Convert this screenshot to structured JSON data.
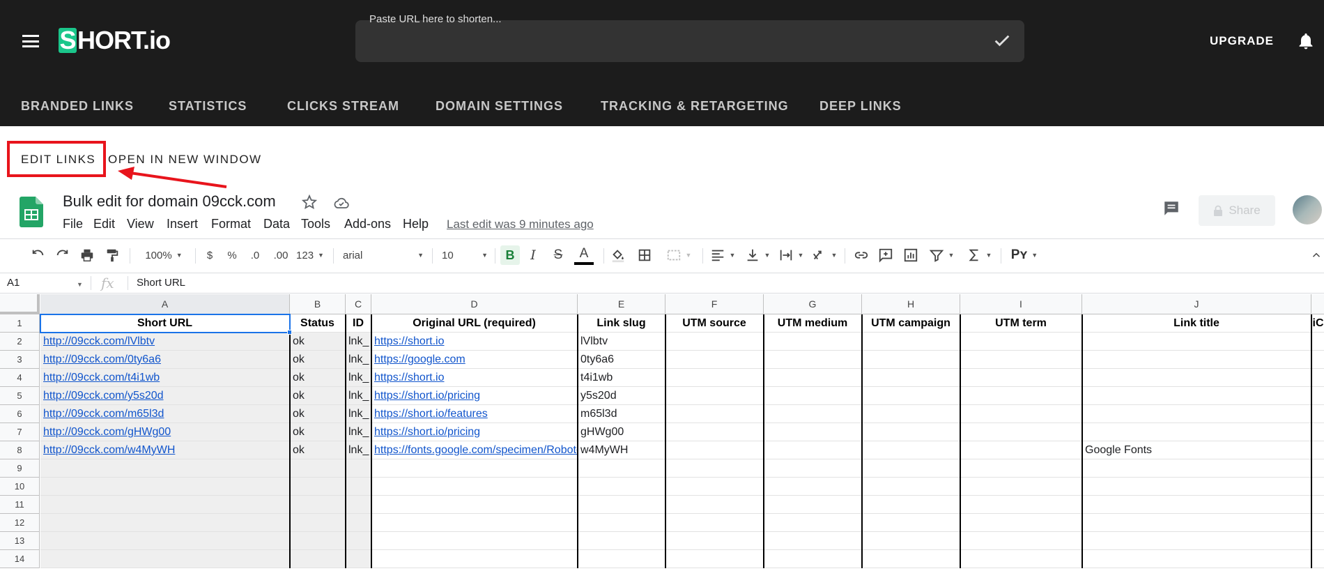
{
  "header": {
    "logo_text": "SHORT.io",
    "url_placeholder": "Paste URL here to shorten...",
    "upgrade_label": "UPGRADE",
    "accent_color": "#1bc68b"
  },
  "nav": {
    "items": [
      "BRANDED LINKS",
      "STATISTICS",
      "CLICKS STREAM",
      "DOMAIN SETTINGS",
      "TRACKING & RETARGETING",
      "DEEP LINKS"
    ]
  },
  "actions": {
    "edit_links": "EDIT LINKS",
    "open_new_window": "OPEN IN NEW WINDOW"
  },
  "sheet": {
    "title": "Bulk edit for domain 09cck.com",
    "menu": [
      "File",
      "Edit",
      "View",
      "Insert",
      "Format",
      "Data",
      "Tools",
      "Add-ons",
      "Help"
    ],
    "last_edit": "Last edit was 9 minutes ago",
    "share_label": "Share"
  },
  "toolbar": {
    "zoom": "100%",
    "currency": "$",
    "percent": "%",
    "dec_decrease": ".0",
    "dec_increase": ".00",
    "more_formats": "123",
    "font": "arial",
    "font_size": "10",
    "bold": "B",
    "italic": "I",
    "strike": "S",
    "text_color": "A"
  },
  "formula": {
    "cell_ref": "A1",
    "fx": "fx",
    "value": "Short URL"
  },
  "grid": {
    "columns": [
      "A",
      "B",
      "C",
      "D",
      "E",
      "F",
      "G",
      "H",
      "I",
      "J"
    ],
    "row_numbers": [
      "1",
      "2",
      "3",
      "4",
      "5",
      "6",
      "7",
      "8",
      "9",
      "10",
      "11",
      "12",
      "13",
      "14"
    ],
    "headers": [
      "Short URL",
      "Status",
      "ID",
      "Original URL (required)",
      "Link slug",
      "UTM source",
      "UTM medium",
      "UTM campaign",
      "UTM term",
      "Link title",
      "iC"
    ],
    "rows": [
      [
        "http://09cck.com/lVlbtv",
        "ok",
        "lnk_",
        "https://short.io",
        "lVlbtv",
        "",
        "",
        "",
        "",
        ""
      ],
      [
        "http://09cck.com/0ty6a6",
        "ok",
        "lnk_",
        "https://google.com",
        "0ty6a6",
        "",
        "",
        "",
        "",
        ""
      ],
      [
        "http://09cck.com/t4i1wb",
        "ok",
        "lnk_",
        "https://short.io",
        "t4i1wb",
        "",
        "",
        "",
        "",
        ""
      ],
      [
        "http://09cck.com/y5s20d",
        "ok",
        "lnk_",
        "https://short.io/pricing",
        "y5s20d",
        "",
        "",
        "",
        "",
        ""
      ],
      [
        "http://09cck.com/m65l3d",
        "ok",
        "lnk_",
        "https://short.io/features",
        "m65l3d",
        "",
        "",
        "",
        "",
        ""
      ],
      [
        "http://09cck.com/gHWg00",
        "ok",
        "lnk_",
        "https://short.io/pricing",
        "gHWg00",
        "",
        "",
        "",
        "",
        ""
      ],
      [
        "http://09cck.com/w4MyWH",
        "ok",
        "lnk_",
        "https://fonts.google.com/specimen/Roboto",
        "w4MyWH",
        "",
        "",
        "",
        "",
        "Google Fonts"
      ]
    ]
  }
}
